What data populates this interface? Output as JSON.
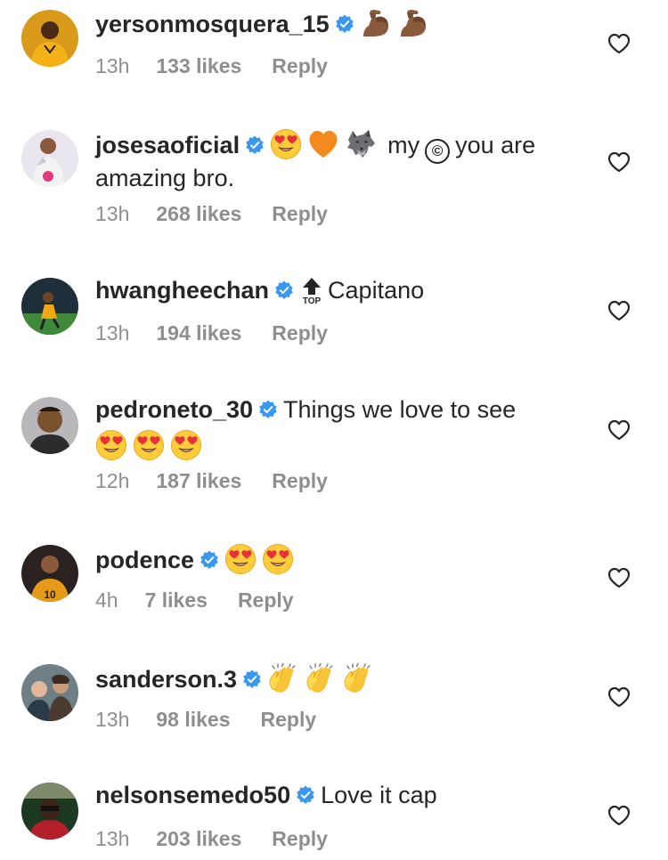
{
  "comments": [
    {
      "username": "yersonmosquera_15",
      "text": "",
      "emojis": [
        "flexed-biceps",
        "flexed-biceps"
      ],
      "time": "13h",
      "likes": "133 likes",
      "reply": "Reply"
    },
    {
      "username": "josesaoficial",
      "text_part1": "my",
      "copyright": "©",
      "text_part2": "you are",
      "text_line2": "amazing bro.",
      "emojis": [
        "heart-eyes",
        "orange-heart",
        "wolf"
      ],
      "time": "13h",
      "likes": "268 likes",
      "reply": "Reply"
    },
    {
      "username": "hwangheechan",
      "top_label": "TOP",
      "text": "Capitano",
      "time": "13h",
      "likes": "194 likes",
      "reply": "Reply"
    },
    {
      "username": "pedroneto_30",
      "text": "Things we love to see",
      "emojis": [
        "heart-eyes",
        "heart-eyes",
        "heart-eyes"
      ],
      "time": "12h",
      "likes": "187 likes",
      "reply": "Reply"
    },
    {
      "username": "podence",
      "text": "",
      "emojis": [
        "heart-eyes",
        "heart-eyes"
      ],
      "time": "4h",
      "likes": "7 likes",
      "reply": "Reply"
    },
    {
      "username": "sanderson.3",
      "text": "",
      "emojis": [
        "clapping-hands",
        "clapping-hands",
        "clapping-hands"
      ],
      "time": "13h",
      "likes": "98 likes",
      "reply": "Reply"
    },
    {
      "username": "nelsonsemedo50",
      "text": "Love it cap",
      "time": "13h",
      "likes": "203 likes",
      "reply": "Reply"
    }
  ],
  "colors": {
    "text": "#262626",
    "meta": "#8e8e8e",
    "verified": "#3897f0",
    "heart_outline": "#262626"
  }
}
